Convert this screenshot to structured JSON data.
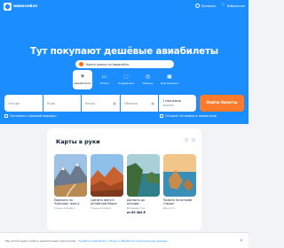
{
  "header": {
    "logo_text": "авиасейлс",
    "profile_label": "Профиль",
    "favorites_label": "Избранное"
  },
  "hero": {
    "headline": "Тут покупают дешёвые авиабилеты",
    "pill_text": "Карта жилья на Авиасейлс"
  },
  "tabs": [
    {
      "label": "Авиабилеты",
      "icon": "plane-icon",
      "active": true
    },
    {
      "label": "Отели",
      "icon": "bed-icon",
      "active": false
    },
    {
      "label": "Поддержка",
      "icon": "chat-icon",
      "active": false
    },
    {
      "label": "Обзоры",
      "icon": "compass-icon",
      "active": false
    },
    {
      "label": "Для бизнеса",
      "icon": "briefcase-icon",
      "active": false
    }
  ],
  "search": {
    "from_placeholder": "Откуда",
    "to_placeholder": "Куда",
    "date_placeholder": "Когда",
    "return_placeholder": "Обратно",
    "passengers_value": "1 пассажир",
    "class_value": "эконом",
    "submit_label": "Найти билеты"
  },
  "options": {
    "complex_route_label": "Составить сложный маршрут",
    "open_hotels_label": "Открыть Островок в новом окне"
  },
  "cards_section": {
    "title": "Карты в руки",
    "items": [
      {
        "title": "Проехать по Чуйскому тракту",
        "meta": "Горно-Алтайск",
        "price": ""
      },
      {
        "title": "Сделать фото в Алтайском Марсе",
        "meta": "Горно-Алтайск",
        "price": ""
      },
      {
        "title": "Доплыть до острова...",
        "meta": "Владивосток",
        "price": "от 80 484 ₽"
      },
      {
        "title": "Пожить на острове Ольхон",
        "meta": "Иркутск",
        "price": ""
      }
    ]
  },
  "cookie": {
    "text": "Мы используем cookie и аналогичные технологии.",
    "link_text": "Узнайте подробнее о сборе и обработке персональных данных"
  },
  "colors": {
    "brand": "#1c8dff",
    "accent": "#ff7a2b"
  }
}
